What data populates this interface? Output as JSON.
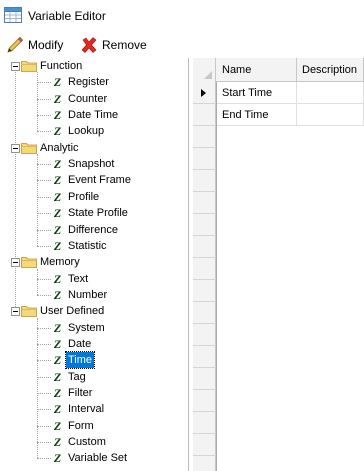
{
  "window": {
    "title": "Variable Editor"
  },
  "toolbar": {
    "modify_label": "Modify",
    "remove_label": "Remove"
  },
  "tree": {
    "groups": [
      {
        "label": "Function",
        "items": [
          "Register",
          "Counter",
          "Date Time",
          "Lookup"
        ]
      },
      {
        "label": "Analytic",
        "items": [
          "Snapshot",
          "Event Frame",
          "Profile",
          "State Profile",
          "Difference",
          "Statistic"
        ]
      },
      {
        "label": "Memory",
        "items": [
          "Text",
          "Number"
        ]
      },
      {
        "label": "User Defined",
        "items": [
          "System",
          "Date",
          "Time",
          "Tag",
          "Filter",
          "Interval",
          "Form",
          "Custom",
          "Variable Set"
        ]
      }
    ],
    "selected": "Time"
  },
  "grid": {
    "columns": [
      "Name",
      "Description"
    ],
    "rows": [
      {
        "name": "Start Time",
        "description": ""
      },
      {
        "name": "End Time",
        "description": ""
      }
    ]
  },
  "icons": {
    "title": "window-grid-icon",
    "modify": "pencil-icon",
    "remove": "red-x-icon",
    "group": "folder-icon",
    "item": "variable-z-icon"
  }
}
